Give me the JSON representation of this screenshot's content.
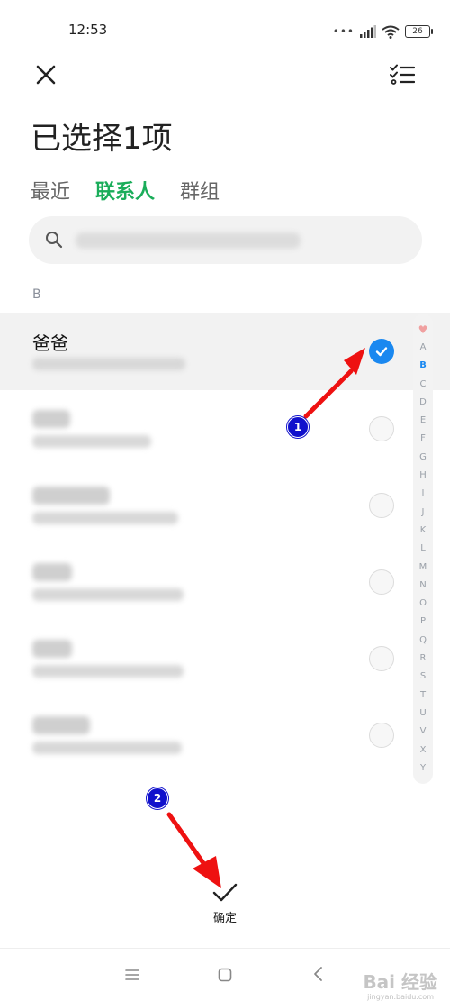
{
  "status_bar": {
    "time": "12:53",
    "signal_dots": "•••",
    "battery": "26"
  },
  "header": {
    "close_icon": "close-icon",
    "multi_select_icon": "checklist-icon",
    "title": "已选择1项"
  },
  "tabs": [
    {
      "label": "最近",
      "active": false
    },
    {
      "label": "联系人",
      "active": true
    },
    {
      "label": "群组",
      "active": false
    }
  ],
  "search": {
    "icon": "search-icon",
    "placeholder": ""
  },
  "section": {
    "letter": "B"
  },
  "contacts": [
    {
      "name": "爸爸",
      "selected": true
    },
    {
      "name": "",
      "selected": false
    },
    {
      "name": "",
      "selected": false
    },
    {
      "name": "",
      "selected": false
    },
    {
      "name": "",
      "selected": false
    },
    {
      "name": "",
      "selected": false
    }
  ],
  "alphabet_index": {
    "favorite_icon": "heart-icon",
    "letters": [
      "A",
      "B",
      "C",
      "D",
      "E",
      "F",
      "G",
      "H",
      "I",
      "J",
      "K",
      "L",
      "M",
      "N",
      "O",
      "P",
      "Q",
      "R",
      "S",
      "T",
      "U",
      "V",
      "X",
      "Y"
    ],
    "active_letter": "B"
  },
  "annotations": {
    "badge_1": "1",
    "badge_2": "2",
    "arrow_color": "#ee1111"
  },
  "confirm": {
    "icon": "checkmark-icon",
    "label": "确定"
  },
  "nav_bar": {
    "menu_icon": "menu-icon",
    "home_icon": "home-icon",
    "back_icon": "back-icon"
  },
  "watermark": {
    "brand": "Bai 经验",
    "url": "jingyan.baidu.com"
  },
  "colors": {
    "accent_green": "#1aad5a",
    "accent_blue": "#1a88f0"
  }
}
